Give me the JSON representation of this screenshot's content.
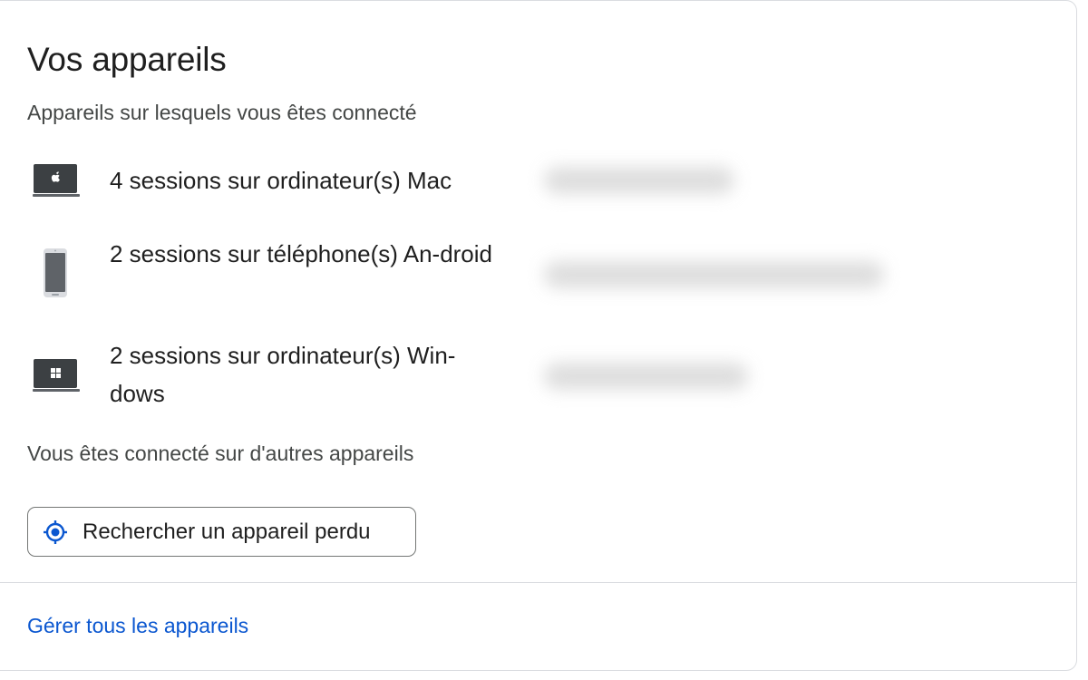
{
  "card": {
    "title": "Vos appareils",
    "subtitle": "Appareils sur lesquels vous êtes connecté",
    "devices": [
      {
        "icon": "mac-laptop-icon",
        "label": "4 sessions sur ordinateur(s) Mac"
      },
      {
        "icon": "android-phone-icon",
        "label": "2 sessions sur téléphone(s) An-droid"
      },
      {
        "icon": "windows-laptop-icon",
        "label": "2 sessions sur ordinateur(s) Win-dows"
      }
    ],
    "other_devices_text": "Vous êtes connecté sur d'autres appareils",
    "find_button_label": "Rechercher un appareil perdu",
    "find_button_icon": "locate-target-icon",
    "manage_link": "Gérer tous les appareils"
  },
  "colors": {
    "accent": "#0b57d0",
    "text_primary": "#1f1f1f",
    "text_secondary": "#444746",
    "border": "#dadce0",
    "device_icon": "#3c4043"
  }
}
